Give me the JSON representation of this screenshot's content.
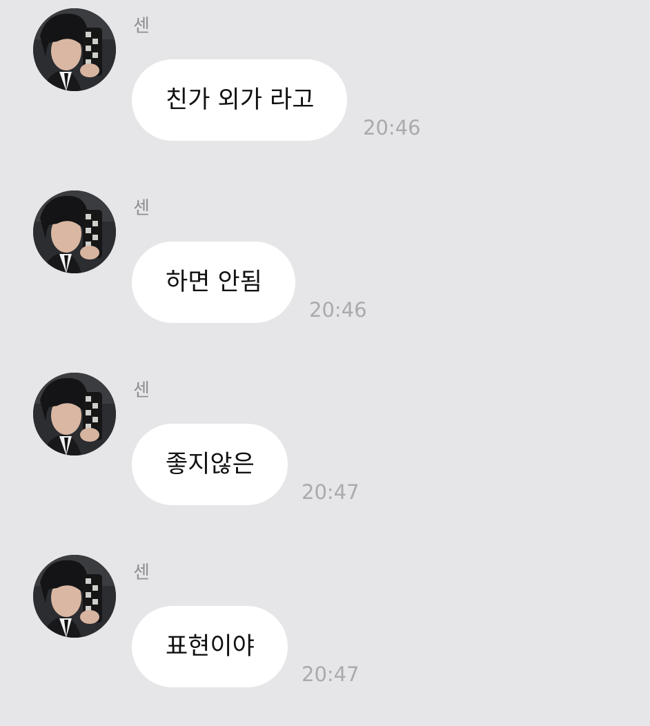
{
  "messages": [
    {
      "sender": "센",
      "text": "친가 외가 라고",
      "time": "20:46"
    },
    {
      "sender": "센",
      "text": "하면 안됨",
      "time": "20:46"
    },
    {
      "sender": "센",
      "text": "좋지않은",
      "time": "20:47"
    },
    {
      "sender": "센",
      "text": "표현이야",
      "time": "20:47"
    }
  ],
  "colors": {
    "background": "#e6e6e8",
    "bubble": "#ffffff",
    "sender": "#8e8e93",
    "timestamp": "#a9a9ae"
  }
}
